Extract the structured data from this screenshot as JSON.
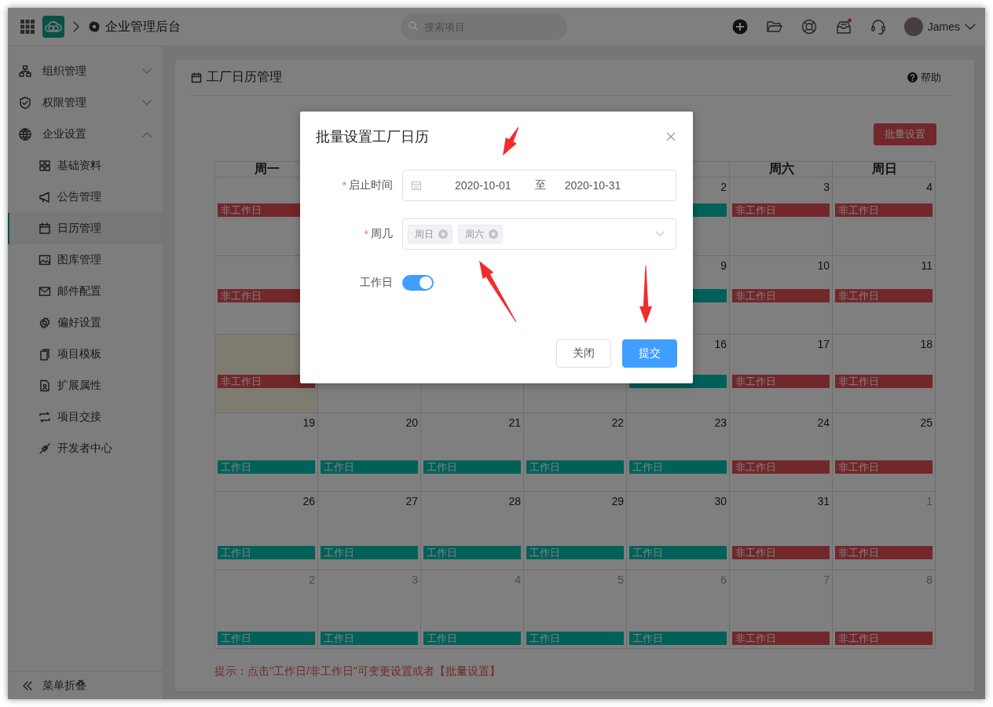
{
  "top_bar": {
    "title": "企业管理后台",
    "search": {
      "placeholder": "搜索项目"
    },
    "user": "James"
  },
  "sidebar": {
    "items": [
      {
        "label": "组织管理",
        "expanded": false
      },
      {
        "label": "权限管理",
        "expanded": false
      },
      {
        "label": "企业设置",
        "expanded": true,
        "children": [
          {
            "label": "基础资料",
            "selected": false
          },
          {
            "label": "公告管理",
            "selected": false
          },
          {
            "label": "日历管理",
            "selected": true
          },
          {
            "label": "图库管理",
            "selected": false
          },
          {
            "label": "邮件配置",
            "selected": false
          },
          {
            "label": "偏好设置",
            "selected": false
          },
          {
            "label": "项目模板",
            "selected": false
          },
          {
            "label": "扩展属性",
            "selected": false
          },
          {
            "label": "项目交接",
            "selected": false
          },
          {
            "label": "开发者中心",
            "selected": false
          }
        ]
      }
    ],
    "collapse": "菜单折叠"
  },
  "panel": {
    "title": "工厂日历管理",
    "help": "帮助",
    "batch_button": "批量设置",
    "calendar": {
      "weekday_headers": {
        "mon": "周一",
        "sat": "周六",
        "sun": "周日"
      },
      "weeks": [
        {
          "mon": {
            "label": "非工作日",
            "kind": "non_workday",
            "today": false
          },
          "fri": {
            "date": "2",
            "kind": "workday",
            "today": false,
            "other_month": false
          },
          "sat": {
            "date": "3",
            "label": "非工作日",
            "kind": "non_workday",
            "today": false,
            "other_month": false
          },
          "sun": {
            "date": "4",
            "label": "非工作日",
            "kind": "non_workday",
            "today": false,
            "other_month": false
          }
        },
        {
          "mon": {
            "label": "非工作日",
            "kind": "non_workday",
            "today": false
          },
          "fri": {
            "date": "9",
            "kind": "workday",
            "today": false,
            "other_month": false
          },
          "sat": {
            "date": "10",
            "label": "非工作日",
            "kind": "non_workday",
            "today": false,
            "other_month": false
          },
          "sun": {
            "date": "11",
            "label": "非工作日",
            "kind": "non_workday",
            "today": false,
            "other_month": false
          }
        },
        {
          "mon": {
            "label": "非工作日",
            "kind": "non_workday",
            "today": true
          },
          "fri": {
            "date": "16",
            "kind": "workday",
            "today": false,
            "other_month": false
          },
          "sat": {
            "date": "17",
            "label": "非工作日",
            "kind": "non_workday",
            "today": false,
            "other_month": false
          },
          "sun": {
            "date": "18",
            "label": "非工作日",
            "kind": "non_workday",
            "today": false,
            "other_month": false
          }
        },
        {
          "mon": {
            "date": "19",
            "label": "工作日",
            "kind": "workday",
            "today": false,
            "other_month": false
          },
          "tue": {
            "date": "20",
            "label": "工作日",
            "kind": "workday",
            "today": false,
            "other_month": false
          },
          "wed": {
            "date": "21",
            "label": "工作日",
            "kind": "workday",
            "today": false,
            "other_month": false
          },
          "thu": {
            "date": "22",
            "label": "工作日",
            "kind": "workday",
            "today": false,
            "other_month": false
          },
          "fri": {
            "date": "23",
            "label": "工作日",
            "kind": "workday",
            "today": false,
            "other_month": false
          },
          "sat": {
            "date": "24",
            "label": "非工作日",
            "kind": "non_workday",
            "today": false,
            "other_month": false
          },
          "sun": {
            "date": "25",
            "label": "非工作日",
            "kind": "non_workday",
            "today": false,
            "other_month": false
          }
        },
        {
          "mon": {
            "date": "26",
            "label": "工作日",
            "kind": "workday",
            "today": false,
            "other_month": false
          },
          "tue": {
            "date": "27",
            "label": "工作日",
            "kind": "workday",
            "today": false,
            "other_month": false
          },
          "wed": {
            "date": "28",
            "label": "工作日",
            "kind": "workday",
            "today": false,
            "other_month": false
          },
          "thu": {
            "date": "29",
            "label": "工作日",
            "kind": "workday",
            "today": false,
            "other_month": false
          },
          "fri": {
            "date": "30",
            "label": "工作日",
            "kind": "workday",
            "today": false,
            "other_month": false
          },
          "sat": {
            "date": "31",
            "label": "非工作日",
            "kind": "non_workday",
            "today": false,
            "other_month": false
          },
          "sun": {
            "date": "1",
            "label": "非工作日",
            "kind": "non_workday",
            "today": false,
            "other_month": true
          }
        },
        {
          "mon": {
            "date": "2",
            "label": "工作日",
            "kind": "workday",
            "today": false,
            "other_month": true
          },
          "tue": {
            "date": "3",
            "label": "工作日",
            "kind": "workday",
            "today": false,
            "other_month": true
          },
          "wed": {
            "date": "4",
            "label": "工作日",
            "kind": "workday",
            "today": false,
            "other_month": true
          },
          "thu": {
            "date": "5",
            "label": "工作日",
            "kind": "workday",
            "today": false,
            "other_month": true
          },
          "fri": {
            "date": "6",
            "label": "工作日",
            "kind": "workday",
            "today": false,
            "other_month": true
          },
          "sat": {
            "date": "7",
            "label": "非工作日",
            "kind": "non_workday",
            "today": false,
            "other_month": true
          },
          "sun": {
            "date": "8",
            "label": "非工作日",
            "kind": "non_workday",
            "today": false,
            "other_month": true
          }
        }
      ]
    },
    "hint": "提示：点击\"工作日/非工作日\"可变更设置或者【批量设置】"
  },
  "dialog": {
    "title": "批量设置工厂日历",
    "fields": [
      {
        "kind": "date_range",
        "label": "启止时间",
        "required_mark": "*",
        "start": "2020-10-01",
        "separator": "至",
        "end": "2020-10-31"
      },
      {
        "kind": "tags",
        "label": "周几",
        "required_mark": "*",
        "tags": [
          "周日",
          "周六"
        ]
      },
      {
        "kind": "switch",
        "label": "工作日",
        "on": true
      }
    ],
    "buttons": [
      {
        "label": "关闭",
        "primary": false
      },
      {
        "label": "提交",
        "primary": true
      }
    ]
  }
}
